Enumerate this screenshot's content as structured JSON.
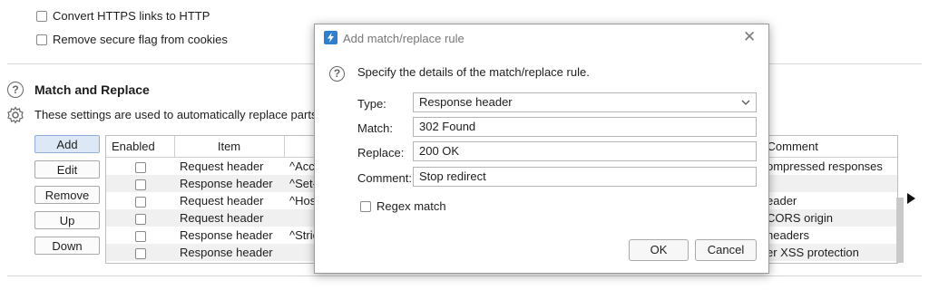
{
  "options": {
    "convert_https": "Convert HTTPS links to HTTP",
    "remove_secure": "Remove secure flag from cookies"
  },
  "section": {
    "title": "Match and Replace",
    "description": "These settings are used to automatically replace parts o"
  },
  "side_buttons": {
    "add": "Add",
    "edit": "Edit",
    "remove": "Remove",
    "up": "Up",
    "down": "Down"
  },
  "table": {
    "headers": {
      "enabled": "Enabled",
      "item": "Item",
      "comment": "Comment"
    },
    "rows": [
      {
        "item": "Request header",
        "match": "^Acce",
        "comment": "ompressed responses"
      },
      {
        "item": "Response header",
        "match": "^Set-",
        "comment": ""
      },
      {
        "item": "Request header",
        "match": "^Hos",
        "comment": "eader"
      },
      {
        "item": "Request header",
        "match": "",
        "comment": "CORS origin"
      },
      {
        "item": "Response header",
        "match": "^Stric",
        "comment": "headers"
      },
      {
        "item": "Response header",
        "match": "",
        "comment": "er XSS protection"
      }
    ]
  },
  "dialog": {
    "title": "Add match/replace rule",
    "info": "Specify the details of the match/replace rule.",
    "type_label": "Type:",
    "type_value": "Response header",
    "match_label": "Match:",
    "match_value": "302 Found",
    "replace_label": "Replace:",
    "replace_value": "200 OK",
    "comment_label": "Comment:",
    "comment_value": "Stop redirect",
    "regex_label": "Regex match",
    "ok": "OK",
    "cancel": "Cancel"
  },
  "colors": {
    "accent": "#2f7fd1",
    "alt_row": "#f0f0f0"
  }
}
